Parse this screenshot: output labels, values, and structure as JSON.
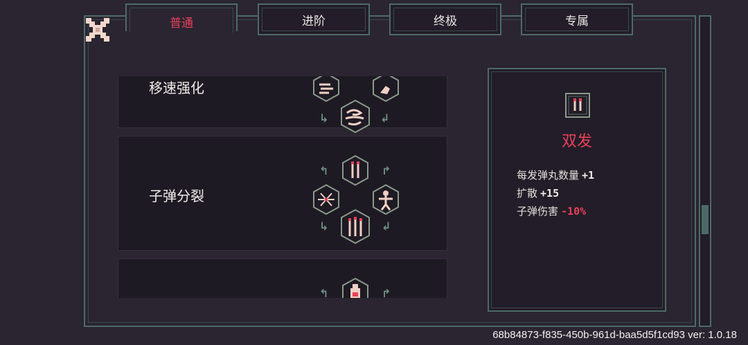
{
  "tabs": [
    {
      "label": "普通",
      "active": true
    },
    {
      "label": "进阶",
      "active": false
    },
    {
      "label": "终极",
      "active": false
    },
    {
      "label": "专属",
      "active": false
    }
  ],
  "close_icon": "close-x-icon",
  "upgrades": [
    {
      "title": "移速强化",
      "icons": [
        "wind-icon",
        "shoe-icon",
        "wind-swirl-icon"
      ]
    },
    {
      "title": "子弹分裂",
      "icons": [
        "double-bullet-icon",
        "spread-burst-icon",
        "split-figure-icon",
        "triple-bullet-icon"
      ]
    },
    {
      "title": "",
      "icons": [
        "bottle-icon"
      ]
    }
  ],
  "detail": {
    "icon": "double-bullet-icon",
    "name": "双发",
    "stats": [
      {
        "label": "每发弹丸数量",
        "value": "+1",
        "kind": "pos"
      },
      {
        "label": "扩散",
        "value": "+15",
        "kind": "pos"
      },
      {
        "label": "子弹伤害",
        "value": "-10%",
        "kind": "neg"
      }
    ]
  },
  "version_text": "68b84873-f835-450b-961d-baa5d5f1cd93 ver: 1.0.18",
  "colors": {
    "accent_red": "#e8405a",
    "border_teal": "#4e6a67",
    "bg": "#2a2530"
  }
}
